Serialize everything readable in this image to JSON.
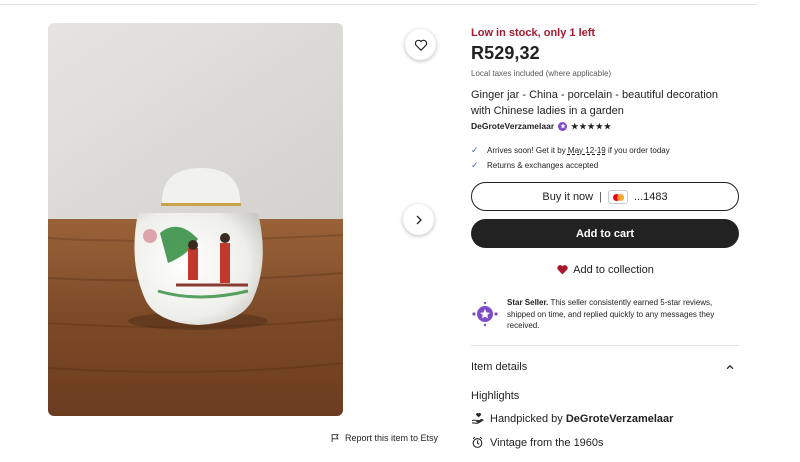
{
  "listing": {
    "stock_text": "Low in stock, only 1 left",
    "price": "R529,32",
    "taxes_note": "Local taxes included (where applicable)",
    "title": "Ginger jar - China - porcelain - beautiful decoration with Chinese ladies in a garden",
    "seller_name": "DeGroteVerzamelaar",
    "rating_stars": "★★★★★",
    "rating_value": 5
  },
  "perks": {
    "arrives_prefix": "Arrives soon! Get it by ",
    "arrives_dates": "May 12-19",
    "arrives_suffix": " if you order today",
    "returns": "Returns & exchanges accepted"
  },
  "actions": {
    "buy_now": "Buy it now",
    "separator": "|",
    "card_last_digits": "...1483",
    "add_to_cart": "Add to cart",
    "add_to_collection": "Add to collection",
    "report": "Report this item to Etsy"
  },
  "star_seller": {
    "label": "Star Seller.",
    "text": " This seller consistently earned 5-star reviews, shipped on time, and replied quickly to any messages they received."
  },
  "details": {
    "heading": "Item details",
    "highlights": "Highlights",
    "handpicked_prefix": "Handpicked by ",
    "handpicked_by": "DeGroteVerzamelaar",
    "vintage": "Vintage from the 1960s"
  },
  "icons": {
    "favorite": "heart-outline-icon",
    "next": "chevron-right-icon",
    "report": "flag-icon",
    "check": "check-icon",
    "collection": "heart-filled-icon",
    "expand": "chevron-up-icon",
    "handpicked": "hand-heart-icon",
    "vintage": "clock-icon"
  },
  "colors": {
    "stock_red": "#a61a2e",
    "star_seller_purple": "#7f4cc9",
    "collection_heart": "#a61a2e",
    "cart_button": "#222222"
  }
}
